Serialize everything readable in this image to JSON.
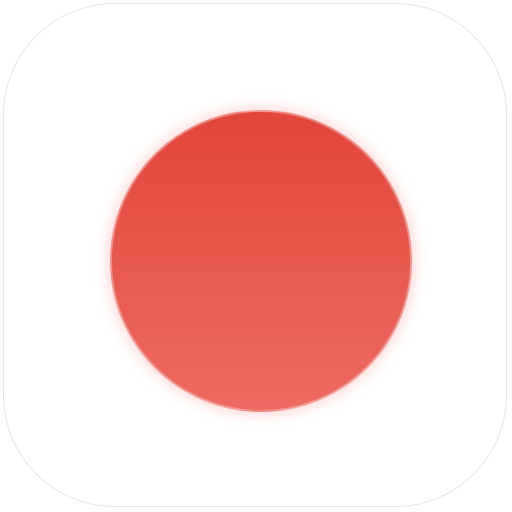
{
  "app_icon": {
    "name": "record-icon",
    "tile_background": "#ffffff",
    "tile_border": "#e6e6e6",
    "dot_color_top": "#e2463b",
    "dot_color_bottom": "#ee6a60"
  }
}
